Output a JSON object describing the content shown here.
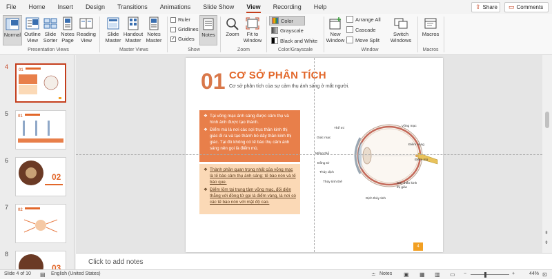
{
  "menubar": {
    "items": [
      "File",
      "Home",
      "Insert",
      "Design",
      "Transitions",
      "Animations",
      "Slide Show",
      "View",
      "Recording",
      "Help"
    ],
    "active": "View",
    "share_label": "Share",
    "comments_label": "Comments"
  },
  "ribbon": {
    "presentation_views": {
      "label": "Presentation Views",
      "normal": "Normal",
      "outline_view": "Outline View",
      "slide_sorter": "Slide Sorter",
      "notes_page": "Notes Page",
      "reading_view": "Reading View"
    },
    "master_views": {
      "label": "Master Views",
      "slide_master": "Slide Master",
      "handout_master": "Handout Master",
      "notes_master": "Notes Master"
    },
    "show": {
      "label": "Show",
      "ruler": "Ruler",
      "gridlines": "Gridlines",
      "guides": "Guides",
      "notes": "Notes",
      "ruler_checked": false,
      "gridlines_checked": false,
      "guides_checked": true
    },
    "zoom": {
      "label": "Zoom",
      "zoom": "Zoom",
      "fit_to_window": "Fit to Window"
    },
    "color_grayscale": {
      "label": "Color/Grayscale",
      "color": "Color",
      "grayscale": "Grayscale",
      "black_and_white": "Black and White"
    },
    "window": {
      "label": "Window",
      "new_window": "New Window",
      "arrange_all": "Arrange All",
      "cascade": "Cascade",
      "move_split": "Move Split",
      "switch_windows": "Switch Windows"
    },
    "macros": {
      "label": "Macros",
      "macros": "Macros"
    }
  },
  "thumbnails": [
    {
      "number": "4",
      "selected": true
    },
    {
      "number": "5",
      "selected": false
    },
    {
      "number": "6",
      "selected": false
    },
    {
      "number": "7",
      "selected": false
    },
    {
      "number": "8",
      "selected": false
    }
  ],
  "slide": {
    "number_big": "01",
    "title": "CƠ SỞ PHÂN TÍCH",
    "subtitle": "Cơ sở phân tích của sự cảm thụ ánh sáng ở mắt người.",
    "orange_bullets": [
      "Tại võng mạc ánh sáng được cảm thụ và hình ảnh được tạo thành.",
      "Điểm mù là nơi các sợi trục thần kinh thị giác đi ra và tạo thành bó dây thần kinh thị giác. Tại đó không có tế bào thụ cảm ánh sáng nên gọi là điểm mù."
    ],
    "peach_bullets": [
      "Thành phần quan trọng nhất của võng mạc là tế bào cảm thụ ánh sáng: tế bào nón và tế bào que.",
      "Điểm lõm tại trung tâm võng mạc, đối diện thẳng với đồng tử gọi là điểm vàng, là nơi có các tế bào nón với mật độ cao."
    ],
    "eye_labels": {
      "the_mi": "Thể mi",
      "vong_mac": "Võng mạc",
      "giac_mac": "Giác mạc",
      "diem_vang": "Điểm vàng",
      "mong_the": "Mống thể",
      "diem_mu": "Điểm mù",
      "dong_tu": "Đồng tử",
      "thuy_dich": "Thủy dịch",
      "thuy_tinh_the": "Thủy tinh thể",
      "day_than_kinh": "Dây thần kinh thị giác",
      "dich_thuy_tinh": "Dịch thủy tinh"
    },
    "page_number": "4"
  },
  "notes": {
    "placeholder": "Click to add notes"
  },
  "statusbar": {
    "slide_info": "Slide 4 of 10",
    "language": "English (United States)",
    "notes_label": "Notes",
    "zoom_level": "44%"
  },
  "colors": {
    "accent": "#c43e1c",
    "slide_orange": "#e87f4a",
    "slide_peach": "#fbd9b6",
    "title_orange": "#e2672a"
  }
}
